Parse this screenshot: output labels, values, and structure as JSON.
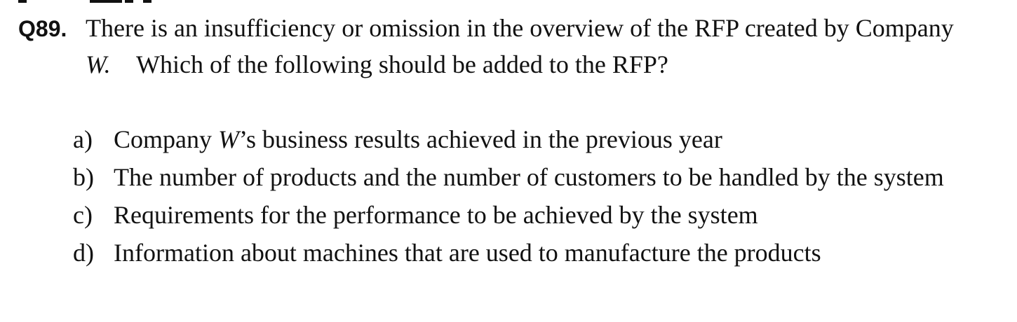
{
  "question": {
    "number": "Q89.",
    "line1": "There is an insufficiency or omission in the overview of the RFP created by Company",
    "company_letter": "W.",
    "line2": "Which of the following should be added to the RFP?"
  },
  "options": [
    {
      "letter": "a)",
      "text_before": "Company ",
      "italic": "W",
      "text_after": "’s business results achieved in the previous year"
    },
    {
      "letter": "b)",
      "text_before": "The number of products and the number of customers to be handled by the system",
      "italic": "",
      "text_after": ""
    },
    {
      "letter": "c)",
      "text_before": "Requirements for the performance to be achieved by the system",
      "italic": "",
      "text_after": ""
    },
    {
      "letter": "d)",
      "text_before": "Information about machines that are used to manufacture the products",
      "italic": "",
      "text_after": ""
    }
  ]
}
